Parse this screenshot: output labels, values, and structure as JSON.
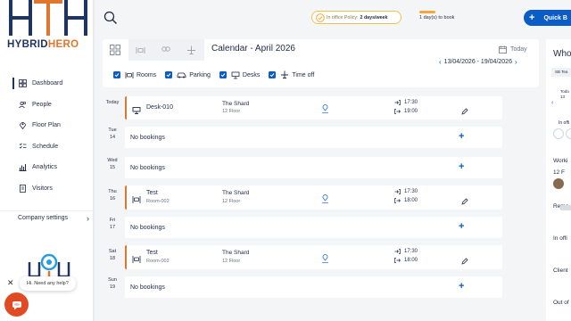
{
  "brand": {
    "word_a": "HYBRID",
    "word_b": "HERO"
  },
  "nav": [
    {
      "label": "Dashboard",
      "icon": "dashboard-icon",
      "active": true
    },
    {
      "label": "People",
      "icon": "people-icon"
    },
    {
      "label": "Floor Plan",
      "icon": "floor-plan-icon"
    },
    {
      "label": "Schedule",
      "icon": "schedule-icon"
    },
    {
      "label": "Analytics",
      "icon": "analytics-icon"
    },
    {
      "label": "Visitors",
      "icon": "visitors-icon"
    }
  ],
  "company_settings": "Company settings",
  "help": {
    "text": "Hi. Need any help?",
    "close": "✕"
  },
  "topbar": {
    "policy_prefix": "In office Policy:",
    "policy_value": "2 days/week",
    "days_text": "1 day(s) to book",
    "quick_label": "Quick B"
  },
  "calendar": {
    "title": "Calendar - April 2026",
    "today_label": "Today",
    "range": "13/04/2026 - 19/04/2026",
    "filters": [
      {
        "label": "Rooms",
        "checked": true,
        "icon": "rooms-icon"
      },
      {
        "label": "Parking",
        "checked": true,
        "icon": "car-icon"
      },
      {
        "label": "Desks",
        "checked": true,
        "icon": "desk-icon"
      },
      {
        "label": "Time off",
        "checked": true,
        "icon": "plane-icon"
      }
    ]
  },
  "days": [
    {
      "dow": "Today",
      "num": "",
      "booking": {
        "icon": "desk-icon",
        "name": "Desk-010",
        "sub": "",
        "location": "The Shard",
        "floor": "12 Floor",
        "start": "17:30",
        "end": "19:00"
      }
    },
    {
      "dow": "Tue",
      "num": "14",
      "empty_text": "No bookings"
    },
    {
      "dow": "Wed",
      "num": "15",
      "empty_text": "No bookings"
    },
    {
      "dow": "Thu",
      "num": "16",
      "booking": {
        "icon": "rooms-icon",
        "name": "Test",
        "sub": "Room-002",
        "location": "The Shard",
        "floor": "12 Floor",
        "start": "17:30",
        "end": "18:00"
      }
    },
    {
      "dow": "Fri",
      "num": "17",
      "empty_text": "No bookings"
    },
    {
      "dow": "Sat",
      "num": "18",
      "booking": {
        "icon": "rooms-icon",
        "name": "Test",
        "sub": "Room-002",
        "location": "The Shard",
        "floor": "12 Floor",
        "start": "17:30",
        "end": "18:00"
      }
    },
    {
      "dow": "Sun",
      "num": "19",
      "empty_text": "No bookings"
    }
  ],
  "right": {
    "title": "Who",
    "team": "SB Tea",
    "today": "Toda",
    "date_short": "13",
    "in_office_small": "In offi",
    "working": "Worki",
    "working_floor": "12 F",
    "remote": "Remo",
    "in_office": "In offi",
    "client": "Client",
    "out": "Out of"
  },
  "colors": {
    "accent": "#0b5cc5",
    "brand_orange": "#e0762b",
    "navy": "#1f3561"
  }
}
